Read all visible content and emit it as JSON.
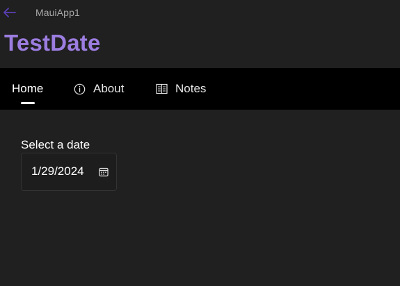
{
  "window": {
    "app_name": "MauiApp1",
    "back_icon": "arrow-left-icon"
  },
  "page": {
    "title": "TestDate"
  },
  "tabs": [
    {
      "label": "Home",
      "icon": "",
      "selected": true
    },
    {
      "label": "About",
      "icon": "info-icon",
      "selected": false
    },
    {
      "label": "Notes",
      "icon": "notes-icon",
      "selected": false
    }
  ],
  "content": {
    "date_label": "Select a date",
    "date_value": "1/29/2024",
    "calendar_icon": "calendar-icon"
  },
  "colors": {
    "background": "#202020",
    "tabbar_background": "#000000",
    "accent": "#9c7de0",
    "back_arrow": "#5b3fb8",
    "text": "#ffffff"
  }
}
